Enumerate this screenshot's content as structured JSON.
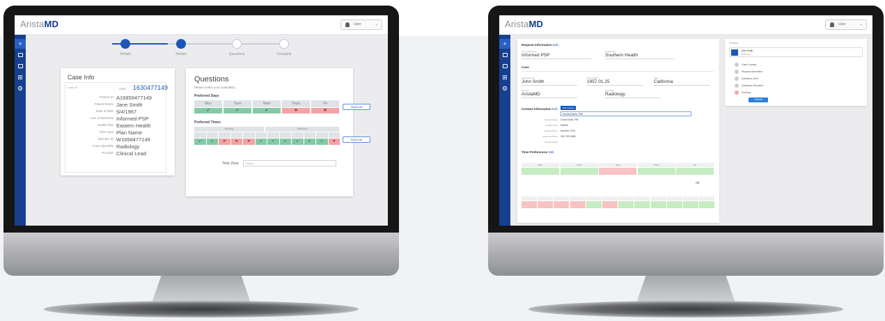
{
  "app": {
    "logo_light": "Arista",
    "logo_bold": "MD",
    "user_menu_label": "User"
  },
  "sidebar": [
    {
      "icon": "plus-icon",
      "glyph": "+"
    },
    {
      "icon": "inbox-icon",
      "glyph": ""
    },
    {
      "icon": "folder-icon",
      "glyph": ""
    },
    {
      "icon": "chart-icon",
      "glyph": "⊞"
    },
    {
      "icon": "gear-icon",
      "glyph": "⚙"
    }
  ],
  "stepper": {
    "steps": [
      {
        "label": "Details",
        "state": "done"
      },
      {
        "label": "Details",
        "state": "done"
      },
      {
        "label": "Questions",
        "state": "todo"
      },
      {
        "label": "Complete",
        "state": "todo"
      }
    ]
  },
  "case_info": {
    "title": "Case Info",
    "case_id_label": "Case ID",
    "case_id_prefix": "case",
    "case_id": "1630477149",
    "rows": [
      {
        "key": "Patient ID",
        "value": "A16859477149"
      },
      {
        "key": "Patient Name",
        "value": "Jane Smith"
      },
      {
        "key": "Date of Birth",
        "value": "5/4/1967"
      },
      {
        "key": "Line of Business",
        "value": "Informed PSP"
      },
      {
        "key": "Health Plan",
        "value": "Eastern Health"
      },
      {
        "key": "Plan Type",
        "value": "Plan Name"
      },
      {
        "key": "Member ID",
        "value": "W1658477149"
      },
      {
        "key": "Case Specialty",
        "value": "Radiology"
      },
      {
        "key": "Provider",
        "value": "Clinical Lead"
      }
    ]
  },
  "questions": {
    "title": "Questions",
    "subtitle": "Please select your availability",
    "preferred_days_label": "Preferred Days",
    "days": [
      "Mon",
      "Tues",
      "Wed",
      "Thurs",
      "Fri"
    ],
    "day_status": [
      "ok",
      "ok",
      "ok",
      "no",
      "no"
    ],
    "select_all_days_label": "Select All",
    "preferred_times_label": "Preferred Times",
    "group_morning": "Morning",
    "group_afternoon": "Afternoon",
    "time_status": [
      "ok",
      "ok",
      "no",
      "no",
      "no",
      "ok",
      "ok",
      "ok",
      "ok",
      "ok",
      "ok",
      "no"
    ],
    "select_all_times_label": "Select All",
    "time_zone_label": "Time Zone",
    "time_zone_placeholder": "Select"
  },
  "detail": {
    "request_info_title": "Request Information",
    "edit_label": "Edit",
    "lob_label": "Line of Business",
    "lob_value": "Informed PSP",
    "health_plan_label": "Health Plan",
    "health_plan_value": "Southern Health",
    "case_title": "Case",
    "patient_name_label": "Patient Name",
    "patient_name_value": "John Smith",
    "dob_label": "Date of Birth",
    "dob_value": "1957.01.25",
    "state_label": "State",
    "state_value": "California",
    "provider_label": "Provider",
    "provider_value": "AristaMD",
    "specialty_label": "Specialty",
    "specialty_value": "Radiology",
    "contact_title": "Contact Information",
    "contact_highlight": "Edit Contact",
    "contact_input_value": "Linda Davis, RN",
    "contact_rows": [
      {
        "key": "Contact Name",
        "value": "Linda Davis, RN"
      },
      {
        "key": "Contact Type",
        "value": "Patient"
      },
      {
        "key": "Contact Phone",
        "value": "Number 1234"
      },
      {
        "key": "Alternate Phone",
        "value": "345 750-5456"
      },
      {
        "key": "Contact Email",
        "value": ""
      }
    ],
    "time_pref_title": "Time Preferences",
    "time_pref_days": [
      "Mon",
      "Tues",
      "Wed",
      "Thurs",
      "Fri"
    ],
    "all_label": "All",
    "timeline_title": "Timeline",
    "timeline_items": [
      "Case Created",
      "Request Submitted",
      "Questions Sent",
      "Questions Received",
      "Pending"
    ],
    "action_button_label": "Submit"
  }
}
